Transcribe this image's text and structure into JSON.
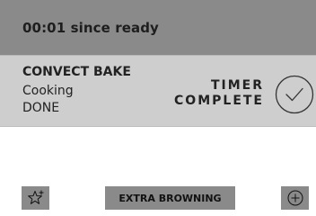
{
  "header": {
    "elapsed_text": "00:01 since ready"
  },
  "status": {
    "mode": "CONVECT BAKE",
    "state": "Cooking",
    "result": "DONE",
    "timer_line1": "TIMER",
    "timer_line2": "COMPLETE",
    "confirm_icon": "check-circle-icon"
  },
  "footer": {
    "favorite_icon": "star-plus-icon",
    "extra_browning_label": "EXTRA BROWNING",
    "add_icon": "plus-circle-icon"
  }
}
